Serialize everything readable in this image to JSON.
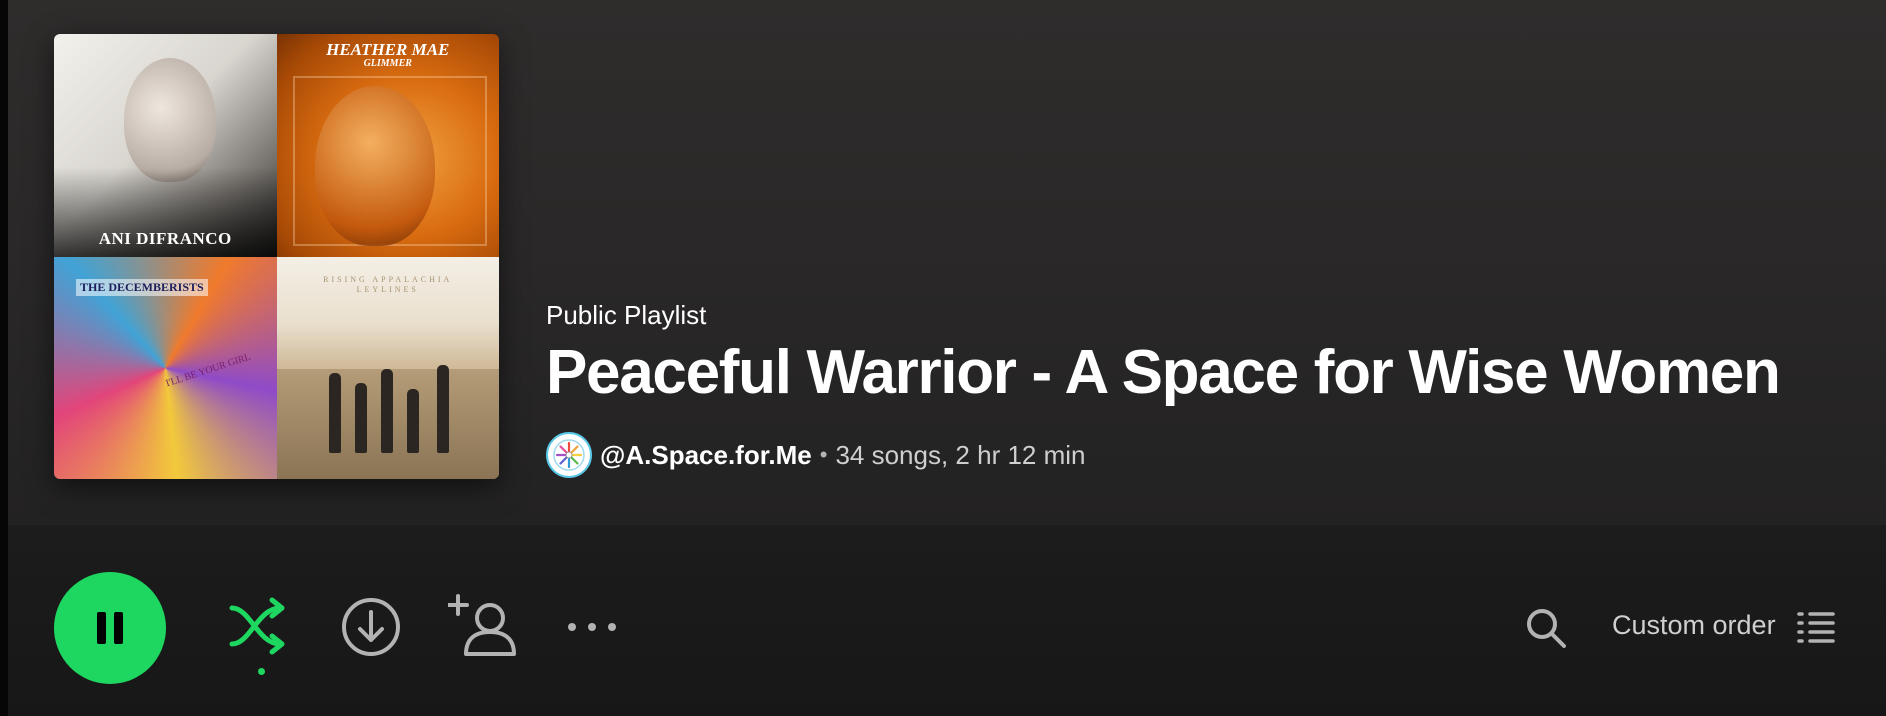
{
  "playlist": {
    "kind": "Public Playlist",
    "title": "Peaceful Warrior - A Space for Wise Women",
    "owner": "@A.Space.for.Me",
    "separator": "•",
    "stats": "34 songs, 2 hr 12 min"
  },
  "cover": {
    "tiles": [
      {
        "text": "ANI DIFRANCO"
      },
      {
        "text": "HEATHER MAE",
        "subtext": "GLIMMER"
      },
      {
        "text": "THE DECEMBERISTS",
        "subtext": "I'LL BE YOUR GIRL"
      },
      {
        "text": "RISING APPALACHIA",
        "subtext": "LEYLINES"
      }
    ]
  },
  "controls": {
    "play_state": "pause",
    "icons": [
      "pause-icon",
      "shuffle-icon",
      "download-icon",
      "add-user-icon",
      "more-icon",
      "search-icon",
      "list-icon"
    ],
    "sort_label": "Custom order"
  },
  "colors": {
    "accent": "#1ed760",
    "background": "#121212",
    "header_background": "#2c2a2a",
    "text_primary": "#ffffff",
    "text_secondary": "#b3b3b3"
  }
}
